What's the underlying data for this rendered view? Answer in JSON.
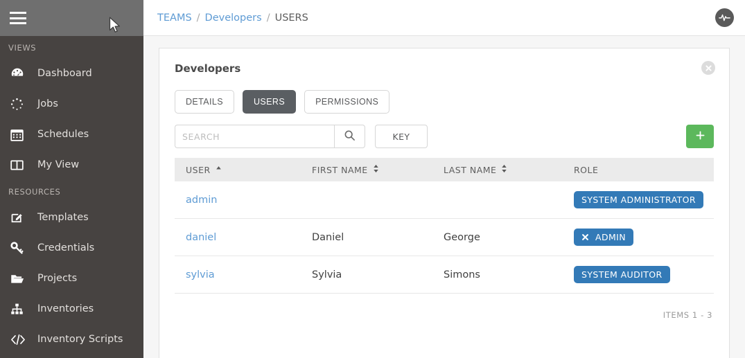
{
  "sidebar": {
    "menu_icon": "hamburger-icon",
    "groups": [
      {
        "label": "VIEWS",
        "items": [
          {
            "label": "Dashboard",
            "icon": "dashboard-gauge-icon"
          },
          {
            "label": "Jobs",
            "icon": "jobs-spinner-icon"
          },
          {
            "label": "Schedules",
            "icon": "calendar-icon"
          },
          {
            "label": "My View",
            "icon": "columns-icon"
          }
        ]
      },
      {
        "label": "RESOURCES",
        "items": [
          {
            "label": "Templates",
            "icon": "pencil-square-icon"
          },
          {
            "label": "Credentials",
            "icon": "key-icon"
          },
          {
            "label": "Projects",
            "icon": "folder-open-icon"
          },
          {
            "label": "Inventories",
            "icon": "sitemap-icon"
          },
          {
            "label": "Inventory Scripts",
            "icon": "code-brackets-icon"
          }
        ]
      }
    ]
  },
  "topbar": {
    "breadcrumb": [
      {
        "label": "TEAMS",
        "type": "link"
      },
      {
        "label": "Developers",
        "type": "link"
      },
      {
        "label": "USERS",
        "type": "current"
      }
    ],
    "separator": "/",
    "status_icon": "activity-pulse-icon"
  },
  "card": {
    "title": "Developers",
    "close_icon": "close-circle-icon",
    "tabs": [
      {
        "label": "DETAILS",
        "active": false
      },
      {
        "label": "USERS",
        "active": true
      },
      {
        "label": "PERMISSIONS",
        "active": false
      }
    ],
    "toolbar": {
      "search_value": "",
      "search_placeholder": "SEARCH",
      "search_icon": "magnifier-icon",
      "key_label": "KEY",
      "add_label": "+",
      "add_color": "#5cb85c"
    },
    "table": {
      "columns": [
        {
          "label": "USER",
          "sort": "asc"
        },
        {
          "label": "FIRST NAME",
          "sort": "both"
        },
        {
          "label": "LAST NAME",
          "sort": "both"
        },
        {
          "label": "ROLE",
          "sort": "none"
        }
      ],
      "rows": [
        {
          "user": "admin",
          "first_name": "",
          "last_name": "",
          "role": "SYSTEM ADMINISTRATOR",
          "role_removable": false
        },
        {
          "user": "daniel",
          "first_name": "Daniel",
          "last_name": "George",
          "role": "ADMIN",
          "role_removable": true
        },
        {
          "user": "sylvia",
          "first_name": "Sylvia",
          "last_name": "Simons",
          "role": "SYSTEM AUDITOR",
          "role_removable": false
        }
      ],
      "badge_color": "#337ab7",
      "items_count": "ITEMS  1 - 3"
    }
  },
  "colors": {
    "sidebar_bg": "#474341",
    "sidebar_top_bg": "#6f6f6f",
    "link_blue": "#5e9bd4",
    "tab_active_bg": "#5a5e62",
    "page_bg": "#f6f6f6"
  }
}
